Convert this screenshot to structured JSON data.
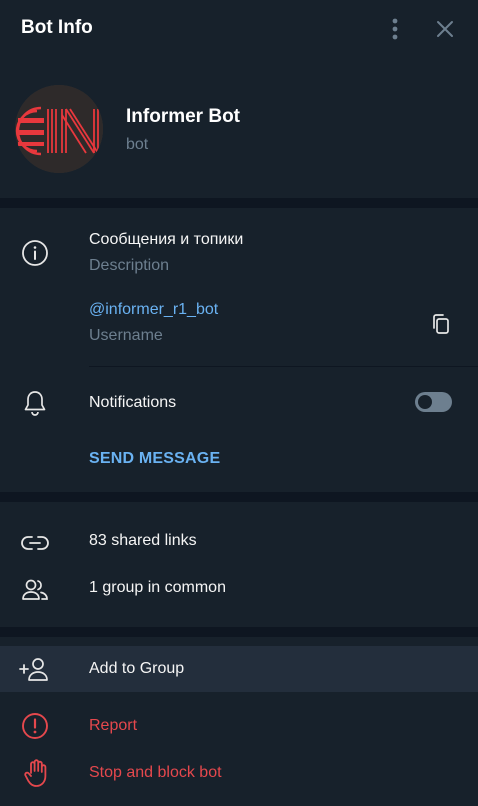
{
  "header": {
    "title": "Bot Info",
    "menu_icon": "more-vertical-icon",
    "close_icon": "close-icon"
  },
  "profile": {
    "name": "Informer Bot",
    "subtitle": "bot",
    "avatar_text": "IN"
  },
  "info": {
    "description_value": "Сообщения и топики",
    "description_label": "Description",
    "username_value": "@informer_r1_bot",
    "username_label": "Username",
    "copy_icon": "copy-icon",
    "info_icon": "info-icon"
  },
  "notifications": {
    "label": "Notifications",
    "enabled": false,
    "icon": "bell-icon"
  },
  "send_message": "SEND MESSAGE",
  "media": {
    "shared_links": "83 shared links",
    "groups_in_common": "1 group in common"
  },
  "actions": {
    "add_to_group": "Add to Group",
    "report": "Report",
    "stop_block": "Stop and block bot"
  },
  "colors": {
    "background": "#17212b",
    "separator": "#0e1621",
    "accent": "#6ab2f2",
    "muted": "#6d7f8f",
    "danger": "#e5484d",
    "hover": "#232e3c"
  }
}
